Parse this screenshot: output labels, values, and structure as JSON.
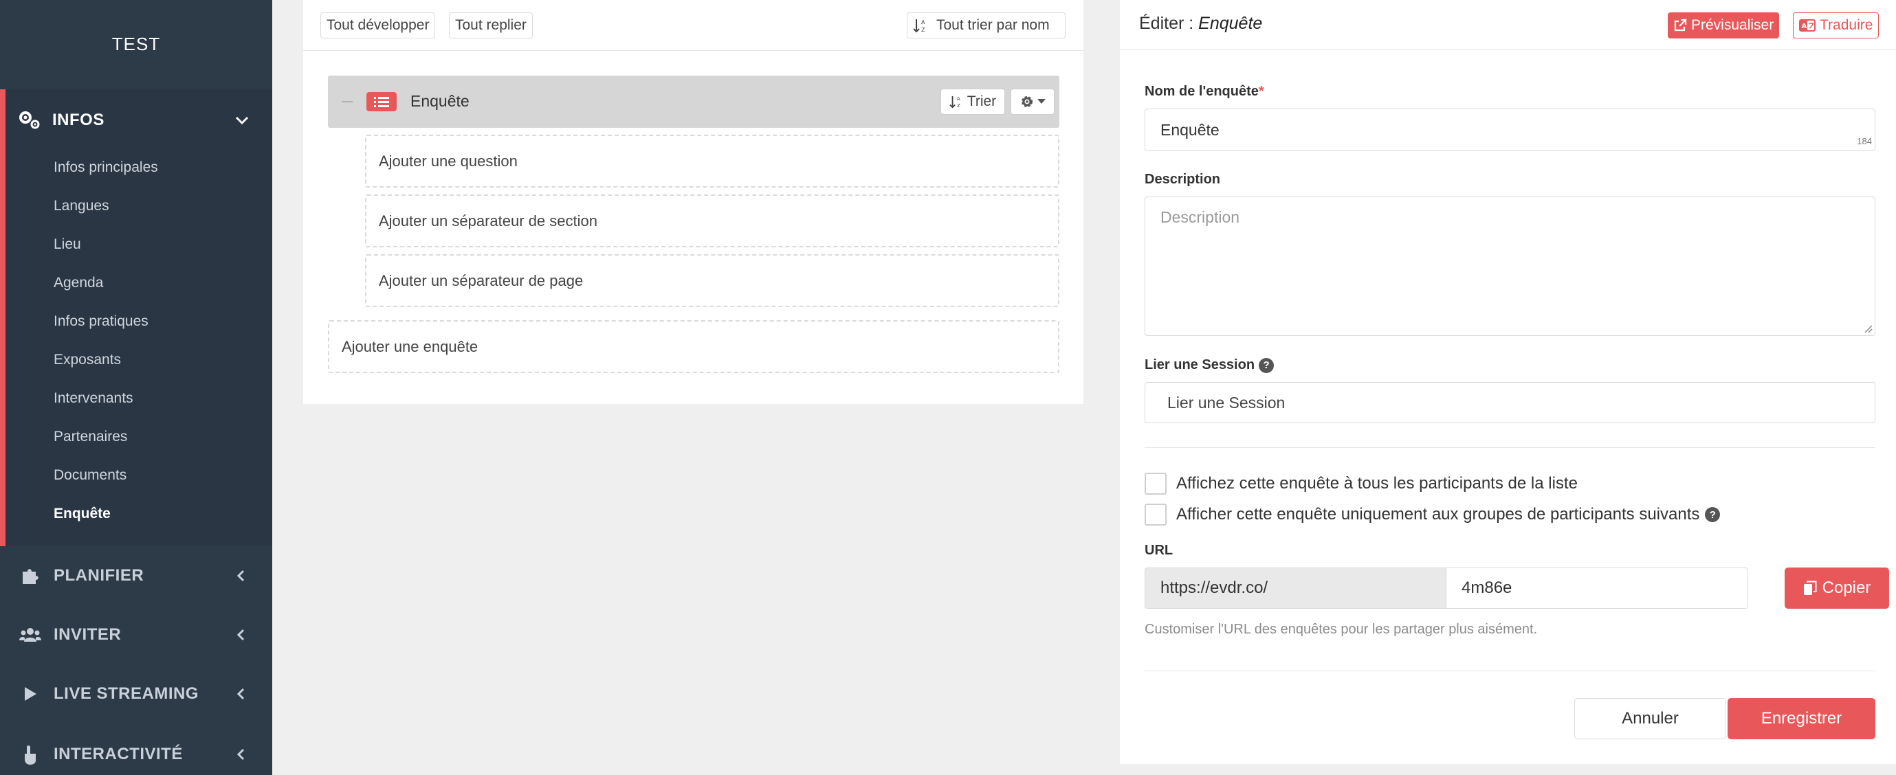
{
  "sidebar": {
    "brand": "TEST",
    "open_section": {
      "label": "INFOS",
      "icon": "gears-icon",
      "items": [
        {
          "label": "Infos principales"
        },
        {
          "label": "Langues"
        },
        {
          "label": "Lieu"
        },
        {
          "label": "Agenda"
        },
        {
          "label": "Infos pratiques"
        },
        {
          "label": "Exposants"
        },
        {
          "label": "Intervenants"
        },
        {
          "label": "Partenaires"
        },
        {
          "label": "Documents"
        },
        {
          "label": "Enquête",
          "active": true
        }
      ]
    },
    "closed_sections": [
      {
        "label": "PLANIFIER",
        "icon": "puzzle-icon"
      },
      {
        "label": "INVITER",
        "icon": "users-icon"
      },
      {
        "label": "LIVE STREAMING",
        "icon": "play-icon"
      },
      {
        "label": "INTERACTIVITÉ",
        "icon": "hand-pointer-icon"
      }
    ]
  },
  "tree": {
    "expand_all": "Tout développer",
    "collapse_all": "Tout replier",
    "sort_all": "Tout trier par nom",
    "survey": {
      "title": "Enquête",
      "sort_label": "Trier"
    },
    "add_question": "Ajouter une question",
    "add_section_separator": "Ajouter un séparateur de section",
    "add_page_separator": "Ajouter un séparateur de page",
    "add_survey": "Ajouter une enquête"
  },
  "editor": {
    "title_prefix": "Éditer :",
    "title_name": "Enquête",
    "preview_label": "Prévisualiser",
    "translate_label": "Traduire",
    "name_label": "Nom de l'enquête",
    "name_required": "*",
    "name_value": "Enquête",
    "name_counter": "184",
    "description_label": "Description",
    "description_placeholder": "Description",
    "session_label": "Lier une Session",
    "session_placeholder": "Lier une Session",
    "checkbox_all": "Affichez cette enquête à tous les participants de la liste",
    "checkbox_groups": "Afficher cette enquête uniquement aux groupes de participants suivants",
    "url_label": "URL",
    "url_prefix": "https://evdr.co/",
    "url_slug": "4m86e",
    "copy_label": "Copier",
    "url_hint": "Customiser l'URL des enquêtes pour les partager plus aisément.",
    "cancel_label": "Annuler",
    "save_label": "Enregistrer"
  },
  "colors": {
    "accent": "#e8585a",
    "sidebar_bg": "#2d3a48"
  }
}
